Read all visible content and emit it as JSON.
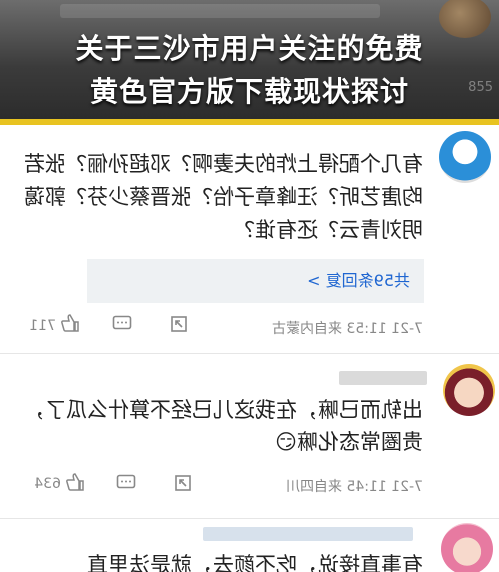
{
  "banner": {
    "title_line1": "关于三沙市用户关注的免费",
    "title_line2": "黄色官方版下载现状探讨",
    "corner_number": "855"
  },
  "comments": [
    {
      "text_lines": [
        "有几个配得上炸的夫妻啊？邓超孙俪？张若",
        "昀唐艺昕？汪峰章子怡？张晋蔡少芬？郭蔼",
        "明刘青云？还有谁？"
      ],
      "replies_label": "共59条回复 >",
      "time_location": "7-21 11:53 来自内蒙古",
      "likes": "711",
      "avatar": "doraemon-avatar"
    },
    {
      "text_lines": [
        "出轨而已嘛，在我这儿已经不算什么瓜了，",
        "贵圈常态化嘛"
      ],
      "emoji": "😏",
      "time_location": "7-21 11:45 来自四川",
      "likes": "634",
      "avatar": "cartoon-girl-avatar"
    },
    {
      "text_lines": [
        "有事直接说，吃不颜去，就是法里直"
      ],
      "avatar": "pink-girl-avatar"
    }
  ],
  "colors": {
    "banner_stripe": "#e8c321",
    "link_blue": "#1f66d1"
  }
}
